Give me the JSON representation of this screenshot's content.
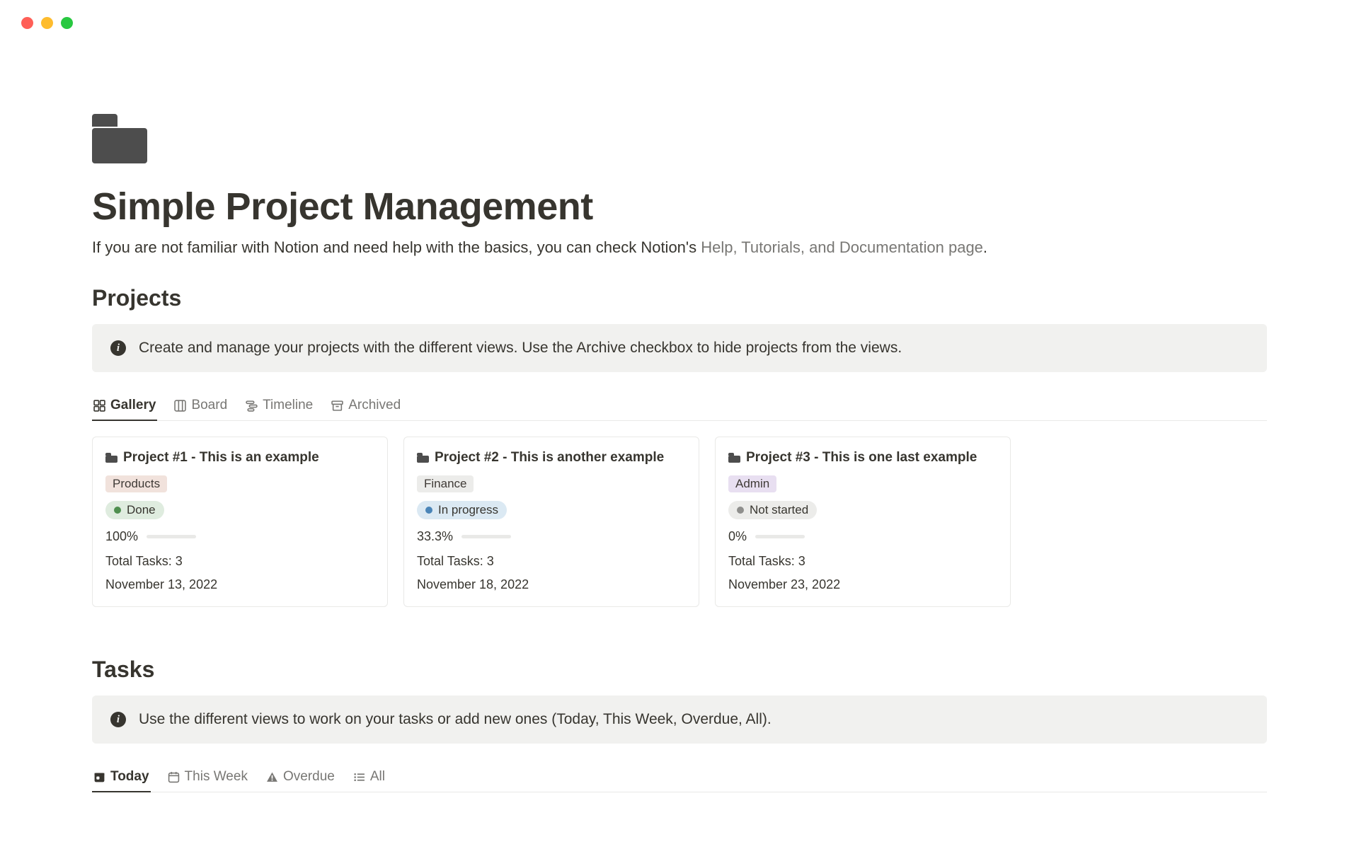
{
  "window": {
    "controls": [
      "close",
      "minimize",
      "maximize"
    ]
  },
  "page": {
    "title": "Simple Project Management",
    "subtitle_pre": "If you are not familiar with Notion and need help with the basics, you can check Notion's ",
    "subtitle_link": "Help, Tutorials, and Documentation page",
    "subtitle_post": "."
  },
  "projects": {
    "heading": "Projects",
    "callout": "Create and manage your projects with the different views. Use the Archive checkbox to hide projects from the views.",
    "tabs": [
      {
        "id": "gallery",
        "label": "Gallery",
        "icon": "gallery-icon",
        "active": true
      },
      {
        "id": "board",
        "label": "Board",
        "icon": "board-icon",
        "active": false
      },
      {
        "id": "timeline",
        "label": "Timeline",
        "icon": "timeline-icon",
        "active": false
      },
      {
        "id": "archived",
        "label": "Archived",
        "icon": "archive-icon",
        "active": false
      }
    ],
    "cards": [
      {
        "title": "Project #1 - This is an example",
        "category": "Products",
        "category_color": "products",
        "status": "Done",
        "status_kind": "done",
        "progress_label": "100%",
        "progress_pct": 100,
        "total_tasks": "Total Tasks: 3",
        "date": "November 13, 2022"
      },
      {
        "title": "Project #2 - This is another example",
        "category": "Finance",
        "category_color": "finance",
        "status": "In progress",
        "status_kind": "inprog",
        "progress_label": "33.3%",
        "progress_pct": 33.3,
        "total_tasks": "Total Tasks: 3",
        "date": "November 18, 2022"
      },
      {
        "title": "Project #3 - This is one last example",
        "category": "Admin",
        "category_color": "admin",
        "status": "Not started",
        "status_kind": "ns",
        "progress_label": "0%",
        "progress_pct": 0,
        "total_tasks": "Total Tasks: 3",
        "date": "November 23, 2022"
      }
    ]
  },
  "tasks": {
    "heading": "Tasks",
    "callout": "Use the different views to work on your tasks or add new ones (Today, This Week, Overdue, All).",
    "tabs": [
      {
        "id": "today",
        "label": "Today",
        "icon": "calendar-today-icon",
        "active": true
      },
      {
        "id": "thisweek",
        "label": "This Week",
        "icon": "calendar-week-icon",
        "active": false
      },
      {
        "id": "overdue",
        "label": "Overdue",
        "icon": "warning-icon",
        "active": false
      },
      {
        "id": "all",
        "label": "All",
        "icon": "list-icon",
        "active": false
      }
    ]
  }
}
